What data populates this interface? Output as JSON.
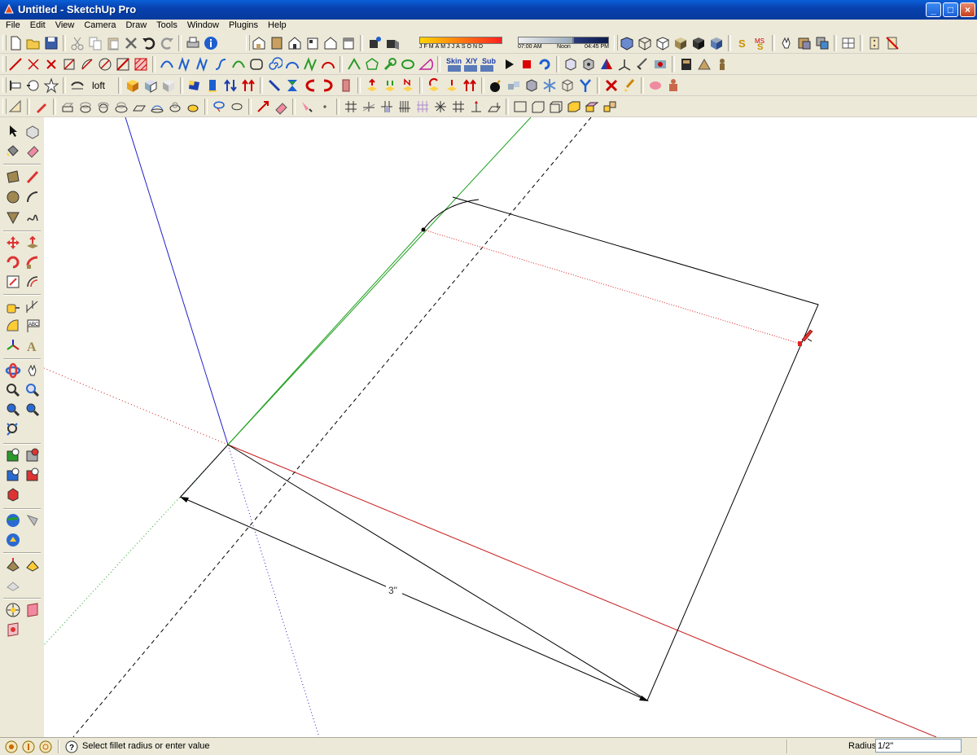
{
  "window": {
    "title": "Untitled - SketchUp Pro",
    "minimize_label": "_",
    "maximize_label": "□",
    "close_label": "×"
  },
  "menu": {
    "items": [
      "File",
      "Edit",
      "View",
      "Camera",
      "Draw",
      "Tools",
      "Window",
      "Plugins",
      "Help"
    ]
  },
  "toolbars": {
    "shadows": {
      "months": [
        "J",
        "F",
        "M",
        "A",
        "M",
        "J",
        "J",
        "A",
        "S",
        "O",
        "N",
        "D"
      ],
      "time_start": "07:00 AM",
      "time_mid": "Noon",
      "time_end": "04:45 PM"
    },
    "loft_label": "loft",
    "skin_label": "Skin",
    "xy_label": "X/Y",
    "sub_label": "Sub"
  },
  "viewport": {
    "dimension_label": "3\"",
    "colors": {
      "red_axis": "#c81e1e",
      "green_axis": "#1ea01e",
      "blue_axis": "#2020c8",
      "inference": "#e02020"
    }
  },
  "status": {
    "message": "Select fillet radius or enter value",
    "vcb_label": "Radius",
    "vcb_value": "1/2\""
  }
}
